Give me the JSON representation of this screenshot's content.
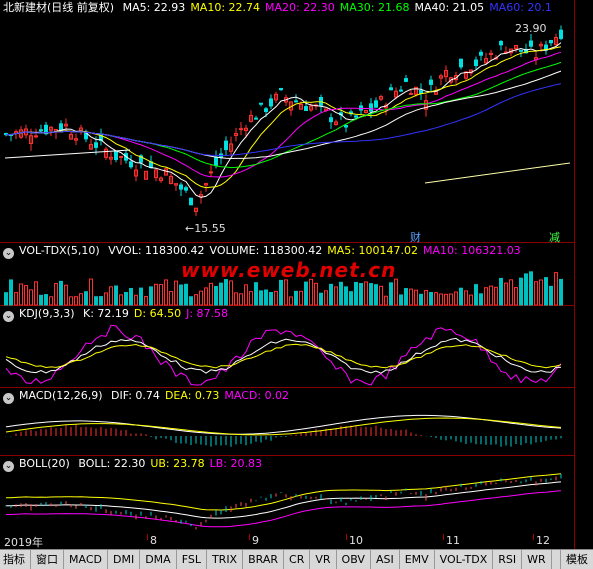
{
  "main": {
    "title": "北新建材(日线 前复权)",
    "ma": [
      {
        "label": "MA5: 22.93",
        "color": "#ffffff"
      },
      {
        "label": "MA10: 22.74",
        "color": "#ffff00"
      },
      {
        "label": "MA20: 22.30",
        "color": "#ff00ff"
      },
      {
        "label": "MA30: 21.68",
        "color": "#00ff00"
      },
      {
        "label": "MA40: 21.05",
        "color": "#ffffff"
      },
      {
        "label": "MA60: 20.1",
        "color": "#3333ff"
      }
    ],
    "high_label": "23.90",
    "low_label": "15.55",
    "marker_left": "财",
    "marker_right": "减"
  },
  "vol": {
    "title": "VOL-TDX(5,10)",
    "items": [
      {
        "label": "VVOL: 118300.42",
        "color": "#ffffff"
      },
      {
        "label": "VOLUME: 118300.42",
        "color": "#ffffff"
      },
      {
        "label": "MA5: 100147.02",
        "color": "#ffff00"
      },
      {
        "label": "MA10: 106321.03",
        "color": "#ff00ff"
      }
    ],
    "watermark": "www.eweb.net.cn"
  },
  "kdj": {
    "title": "KDJ(9,3,3)",
    "items": [
      {
        "label": "K: 72.19",
        "color": "#ffffff"
      },
      {
        "label": "D: 64.50",
        "color": "#ffff00"
      },
      {
        "label": "J: 87.58",
        "color": "#ff00ff"
      }
    ]
  },
  "macd": {
    "title": "MACD(12,26,9)",
    "items": [
      {
        "label": "DIF: 0.74",
        "color": "#ffffff"
      },
      {
        "label": "DEA: 0.73",
        "color": "#ffff00"
      },
      {
        "label": "MACD: 0.02",
        "color": "#ff00ff"
      }
    ]
  },
  "boll": {
    "title": "BOLL(20)",
    "items": [
      {
        "label": "BOLL: 22.30",
        "color": "#ffffff"
      },
      {
        "label": "UB: 23.78",
        "color": "#ffff00"
      },
      {
        "label": "LB: 20.83",
        "color": "#ff00ff"
      }
    ]
  },
  "axis": {
    "year": "2019年",
    "months": [
      "8",
      "9",
      "10",
      "11",
      "12"
    ]
  },
  "tabs": [
    "指标",
    "窗口",
    "MACD",
    "DMI",
    "DMA",
    "FSL",
    "TRIX",
    "BRAR",
    "CR",
    "VR",
    "OBV",
    "ASI",
    "EMV",
    "VOL-TDX",
    "RSI",
    "WR"
  ],
  "template_tab": "模板",
  "dot_glyph": "⌄"
}
